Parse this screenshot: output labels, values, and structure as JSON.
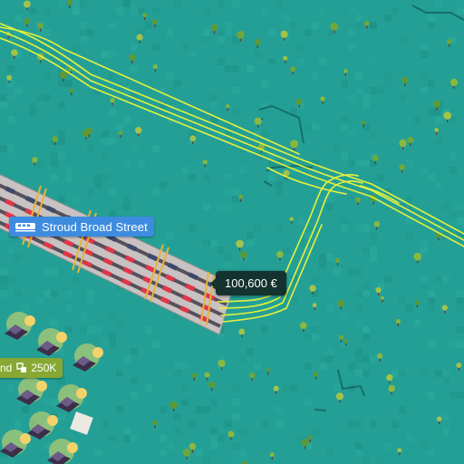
{
  "station": {
    "name": "Stroud Broad Street"
  },
  "cost": {
    "label": "100,600 €"
  },
  "town": {
    "name": "nd",
    "population": "250K"
  },
  "colors": {
    "ground": "#249f96",
    "rail": "#e3f23c",
    "station_platform": "#c9c2c2",
    "station_label_bg": "#3d8ce0",
    "cost_tag_bg": "#14322e",
    "town_label_bg": "#87a833"
  },
  "icons": {
    "station": "train-icon",
    "population": "population-icon"
  }
}
